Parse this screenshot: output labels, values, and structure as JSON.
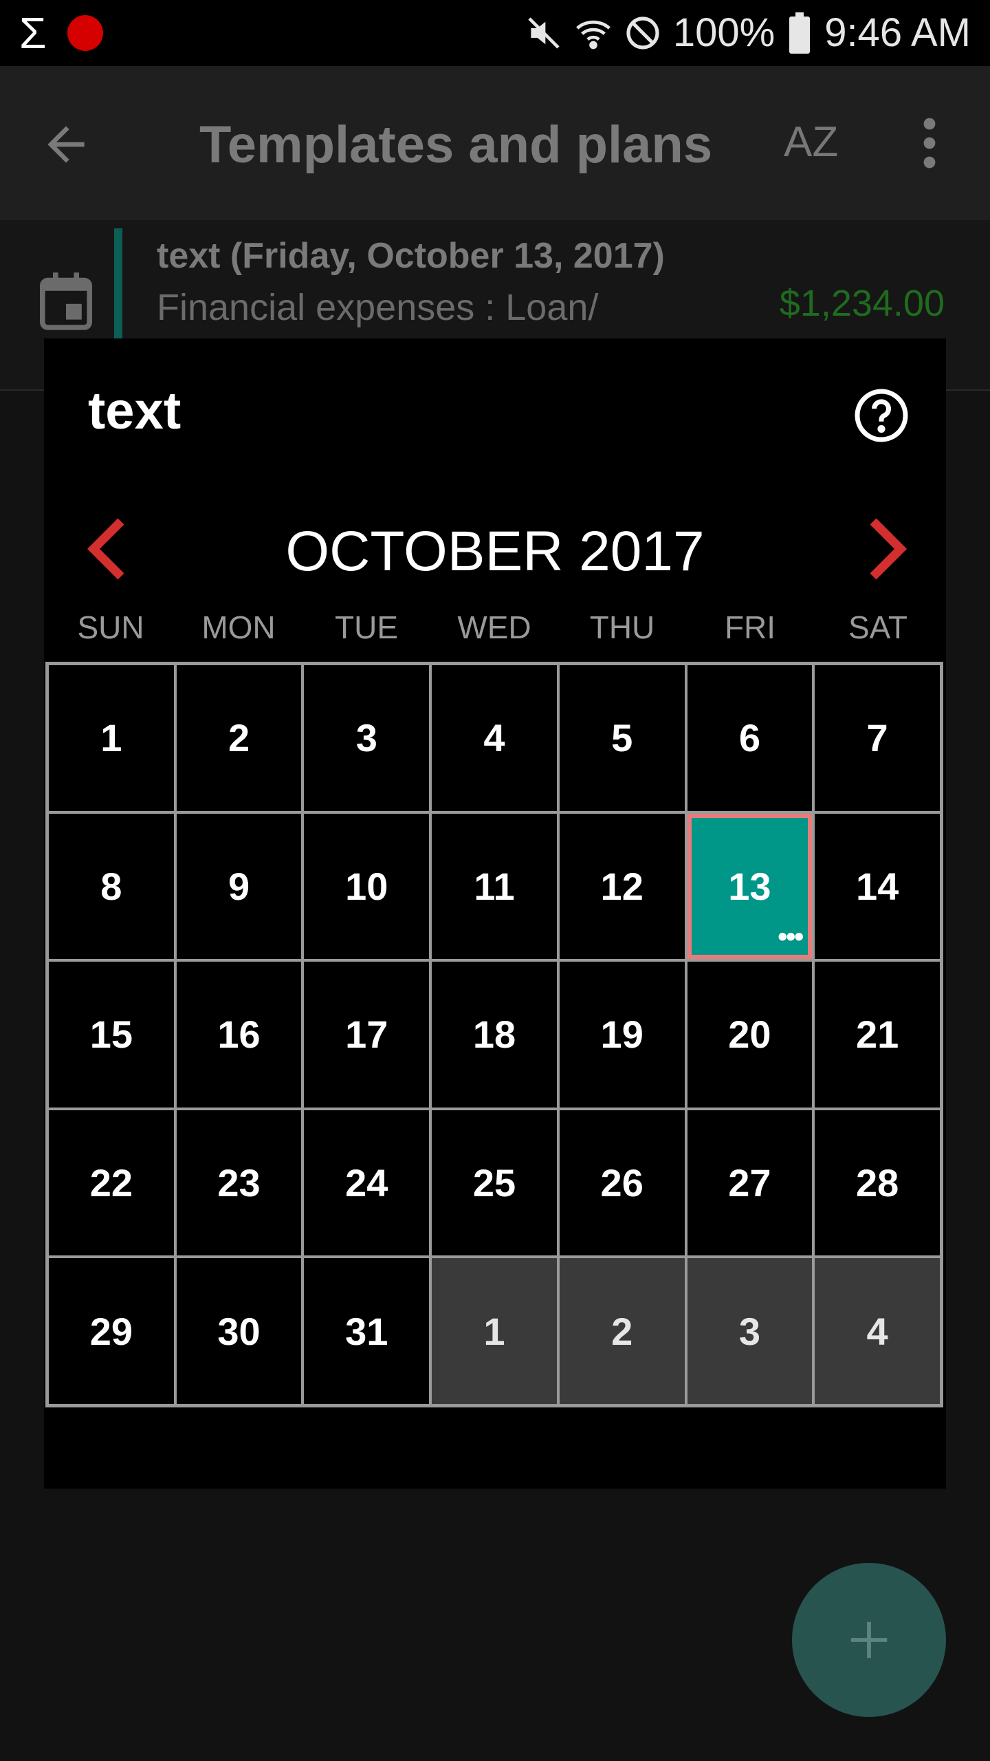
{
  "status_bar": {
    "battery": "100%",
    "time": "9:46 AM",
    "icons": [
      "sigma-icon",
      "record-icon",
      "mute-icon",
      "wifi-icon",
      "do-not-disturb-icon",
      "battery-icon"
    ]
  },
  "toolbar": {
    "title": "Templates and plans",
    "sort_label": "AZ"
  },
  "list": {
    "items": [
      {
        "title": "text (Friday, October 13, 2017)",
        "subtitle": "Financial expenses : Loan/",
        "amount": "$1,234.00"
      }
    ]
  },
  "dialog": {
    "title": "text",
    "month_label": "OCTOBER 2017",
    "weekdays": [
      "SUN",
      "MON",
      "TUE",
      "WED",
      "THU",
      "FRI",
      "SAT"
    ],
    "days": [
      "1",
      "2",
      "3",
      "4",
      "5",
      "6",
      "7",
      "8",
      "9",
      "10",
      "11",
      "12",
      "13",
      "14",
      "15",
      "16",
      "17",
      "18",
      "19",
      "20",
      "21",
      "22",
      "23",
      "24",
      "25",
      "26",
      "27",
      "28",
      "29",
      "30",
      "31",
      "1",
      "2",
      "3",
      "4"
    ],
    "selected_day": "13",
    "selected_indicator": "•••"
  },
  "colors": {
    "selected_fill": "#009688",
    "selected_border": "#e87c7c",
    "nav_arrow": "#d32f2f",
    "amount": "#1f6b1f",
    "fab": "#27544f"
  }
}
